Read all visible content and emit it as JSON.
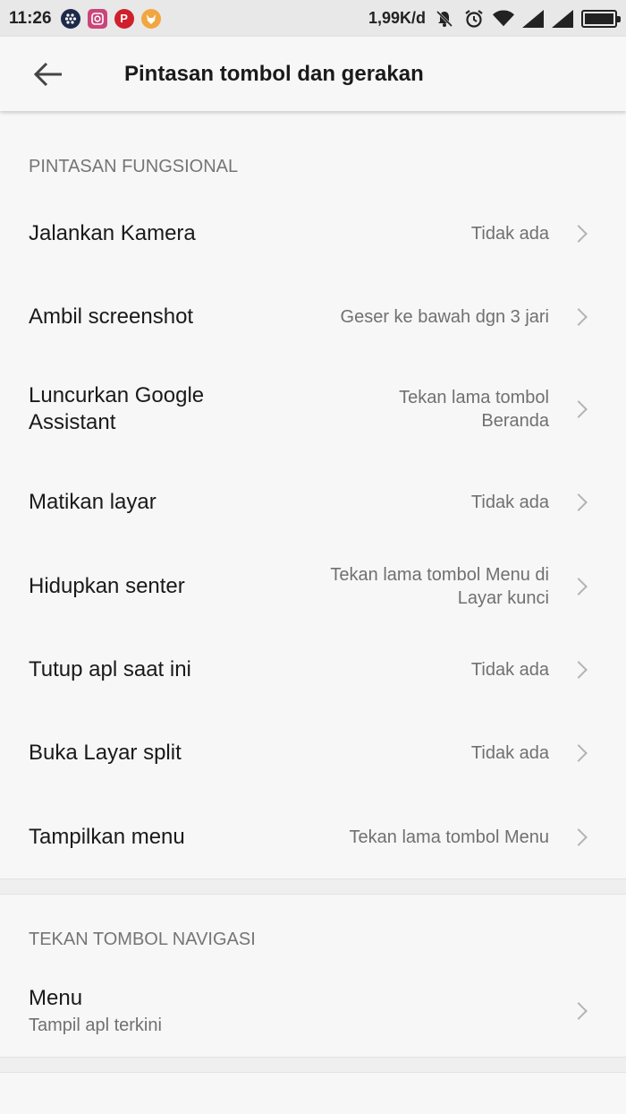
{
  "status_bar": {
    "time": "11:26",
    "net_speed": "1,99K/d",
    "app_icons": [
      "bbm-icon",
      "instagram-icon",
      "pinterest-icon",
      "fox-icon"
    ],
    "colors": {
      "bbm": "#1e2a4a",
      "instagram": "#c9457a",
      "pinterest": "#d0202b",
      "fox": "#f2a640"
    }
  },
  "app_bar": {
    "title": "Pintasan tombol dan gerakan",
    "back_icon": "arrow-left-icon"
  },
  "sections": [
    {
      "header": "PINTASAN FUNGSIONAL",
      "items": [
        {
          "label": "Jalankan Kamera",
          "value": "Tidak ada"
        },
        {
          "label": "Ambil screenshot",
          "value": "Geser ke bawah dgn 3 jari"
        },
        {
          "label": "Luncurkan Google Assistant",
          "value": "Tekan lama tombol Beranda"
        },
        {
          "label": "Matikan layar",
          "value": "Tidak ada"
        },
        {
          "label": "Hidupkan senter",
          "value": "Tekan lama tombol Menu di Layar kunci"
        },
        {
          "label": "Tutup apl saat ini",
          "value": "Tidak ada"
        },
        {
          "label": "Buka Layar split",
          "value": "Tidak ada"
        },
        {
          "label": "Tampilkan menu",
          "value": "Tekan lama tombol Menu"
        }
      ]
    },
    {
      "header": "TEKAN TOMBOL NAVIGASI",
      "items": [
        {
          "label": "Menu",
          "subtitle": "Tampil apl terkini"
        }
      ]
    }
  ]
}
